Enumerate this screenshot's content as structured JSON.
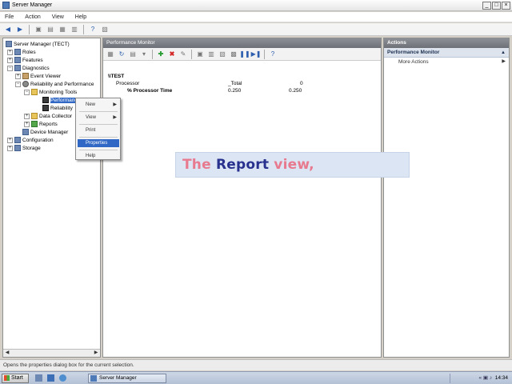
{
  "window": {
    "title": "Server Manager",
    "controls": [
      "_",
      "□",
      "×"
    ]
  },
  "menubar": [
    "File",
    "Action",
    "View",
    "Help"
  ],
  "tree": {
    "items": [
      {
        "label": "Server Manager (TECT)",
        "level": 0,
        "icon": "server-icon"
      },
      {
        "label": "Roles",
        "level": 1,
        "icon": "roles-icon",
        "expander": "+"
      },
      {
        "label": "Features",
        "level": 1,
        "icon": "features-icon",
        "expander": "+"
      },
      {
        "label": "Diagnostics",
        "level": 1,
        "icon": "diagnostics-icon",
        "expander": "−"
      },
      {
        "label": "Event Viewer",
        "level": 2,
        "icon": "event-viewer-icon",
        "expander": "+"
      },
      {
        "label": "Reliability and Performance",
        "level": 2,
        "icon": "gear-icon",
        "expander": "−"
      },
      {
        "label": "Monitoring Tools",
        "level": 3,
        "icon": "folder-icon",
        "expander": "−"
      },
      {
        "label": "Performance Monit",
        "level": 4,
        "icon": "monitor-icon",
        "selected": true
      },
      {
        "label": "Reliability",
        "level": 4,
        "icon": "monitor-icon"
      },
      {
        "label": "Data Collector",
        "level": 3,
        "icon": "folder-icon",
        "expander": "+"
      },
      {
        "label": "Reports",
        "level": 3,
        "icon": "reports-icon",
        "expander": "+"
      },
      {
        "label": "Device Manager",
        "level": 2,
        "icon": "device-manager-icon"
      },
      {
        "label": "Configuration",
        "level": 1,
        "icon": "configuration-icon",
        "expander": "+"
      },
      {
        "label": "Storage",
        "level": 1,
        "icon": "storage-icon",
        "expander": "+"
      }
    ]
  },
  "context_menu": {
    "items": [
      {
        "label": "New",
        "submenu": true
      },
      {
        "label": "View",
        "submenu": true
      },
      {
        "label": "Print"
      },
      {
        "label": "Properties",
        "highlighted": true
      },
      {
        "label": "Help"
      }
    ]
  },
  "performance_monitor": {
    "header": "Performance Monitor",
    "machine": "\\\\TEST",
    "object": "Processor",
    "instance": "_Total",
    "counter": "% Processor Time",
    "value": "0.250",
    "second_value": "0.250",
    "instance_index": "0"
  },
  "overlay": {
    "word1": "The",
    "word2": "Report",
    "word3": "view,"
  },
  "actions": {
    "header": "Actions",
    "section": "Performance Monitor",
    "items": [
      "More Actions"
    ]
  },
  "status_text": "Opens the properties dialog box for the current selection.",
  "taskbar": {
    "start_label": "Start",
    "task_label": "Server Manager",
    "clock": "14:34"
  }
}
